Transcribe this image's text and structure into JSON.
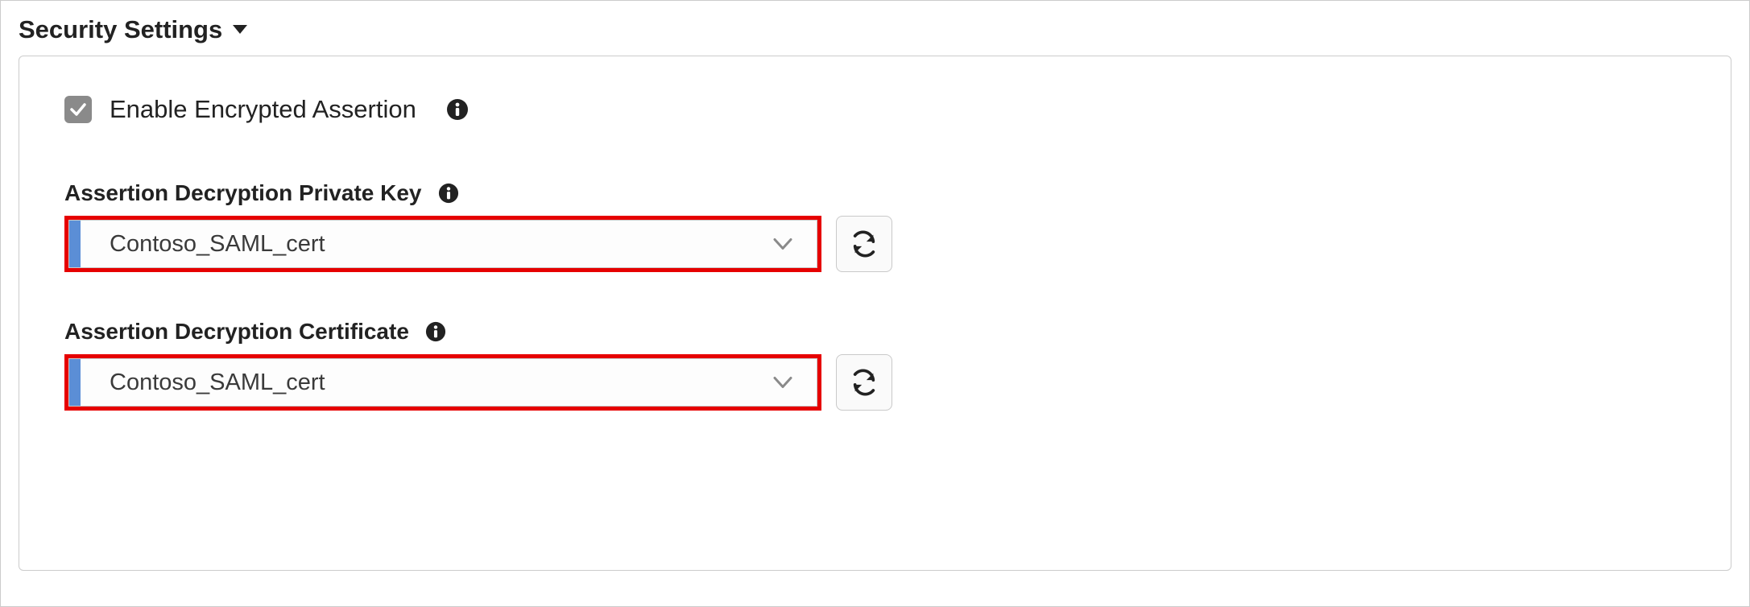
{
  "section": {
    "title": "Security Settings"
  },
  "checkbox": {
    "label": "Enable Encrypted Assertion",
    "checked": true
  },
  "fields": {
    "private_key": {
      "label": "Assertion Decryption Private Key",
      "value": "Contoso_SAML_cert"
    },
    "certificate": {
      "label": "Assertion Decryption Certificate",
      "value": "Contoso_SAML_cert"
    }
  },
  "colors": {
    "highlight_border": "#e60000",
    "select_accent": "#5b8ed6",
    "checkbox_bg": "#8a8a8a"
  }
}
